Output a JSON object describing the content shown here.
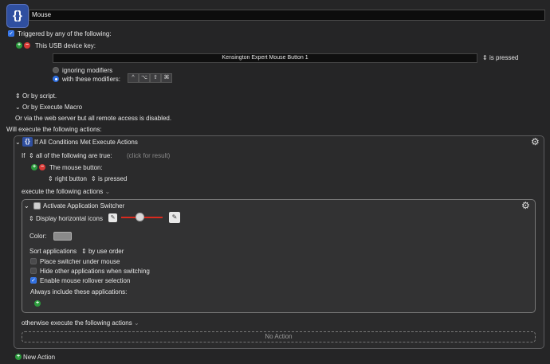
{
  "macro": {
    "icon_glyph": "{}",
    "name": "Mouse"
  },
  "trigger": {
    "header": "Triggered by any of the following:",
    "usb_label": "This USB device key:",
    "device_key": "Kensington Expert Mouse Button 1",
    "key_state": "is pressed",
    "ignoring_modifiers": "ignoring modifiers",
    "with_modifiers": "with these modifiers:",
    "modifier_keys": [
      "^",
      "⌥",
      "⇧",
      "⌘"
    ],
    "or_by_script": "Or by script.",
    "or_by_execute_macro": "Or by Execute Macro",
    "web_server_note": "Or via the web server but all remote access is disabled."
  },
  "actions_header": "Will execute the following actions:",
  "if_action": {
    "title": "If All Conditions Met Execute Actions",
    "if_word": "If",
    "condition_mode": "all of the following are true:",
    "click_for_result": "(click for result)",
    "mouse_button_label": "The mouse button:",
    "mouse_button": "right button",
    "mouse_state": "is pressed",
    "execute_label": "execute the following actions",
    "otherwise_label": "otherwise execute the following actions",
    "no_action": "No Action"
  },
  "switcher": {
    "title": "Activate Application Switcher",
    "display_mode": "Display horizontal icons",
    "color_label": "Color:",
    "sort_label": "Sort applications",
    "sort_value": "by use order",
    "opt_place_under_mouse": "Place switcher under mouse",
    "opt_hide_other": "Hide other applications when switching",
    "opt_mouse_rollover": "Enable mouse rollover selection",
    "always_include": "Always include these applications:",
    "icon_size_level": 0.45
  },
  "new_action": "New Action",
  "colors": {
    "accent": "#2f6fe0",
    "green": "#2c9b3d",
    "red": "#d83a36",
    "slider": "#d92a1e"
  }
}
